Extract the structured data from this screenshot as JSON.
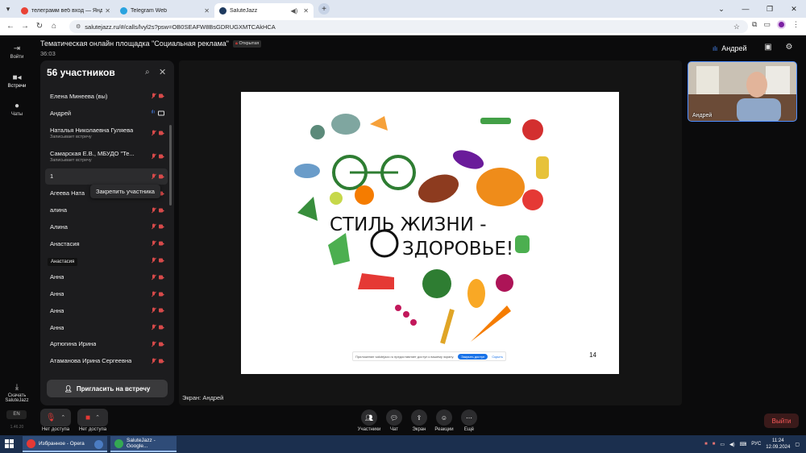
{
  "browser": {
    "tabs": [
      {
        "label": "телеграмм веб вход — Яндекс...",
        "color": "#e94235"
      },
      {
        "label": "Telegram Web",
        "color": "#2aa3df"
      },
      {
        "label": "SaluteJazz",
        "color": "#1e3a5f"
      }
    ],
    "url": "salutejazz.ru/#/calls/lvyl2s?psw=OB0SEAFW8BsGDRUGXMTCAkHCA"
  },
  "app": {
    "title": "Тематическая онлайн площадка \"Социальная реклама\"",
    "open_badge": "Открытая",
    "timer": "36:03",
    "user_name": "Андрей",
    "rail": [
      {
        "label": "Войти",
        "icon": "login-icon"
      },
      {
        "label": "Встречи",
        "icon": "video-icon"
      },
      {
        "label": "Чаты",
        "icon": "chat-icon"
      },
      {
        "label": "Скачать SaluteJazz",
        "icon": "download-icon"
      }
    ],
    "lang": "EN",
    "version": "1.46.20"
  },
  "participants": {
    "title": "56 участников",
    "rows": [
      {
        "name": "Елена Минеева (вы)",
        "sub": "",
        "icons": "off"
      },
      {
        "name": "Андрей",
        "sub": "",
        "icons": "on"
      },
      {
        "name": "Наталья Николаевна Гуляева",
        "sub": "Записывает встречу",
        "icons": "off"
      },
      {
        "name": "Самарская Е.В., МБУДО \"Те...",
        "sub": "Записывает встречу",
        "icons": "off"
      },
      {
        "name": "1",
        "sub": "",
        "icons": "off"
      },
      {
        "name": "Агеева Ната",
        "sub": "",
        "icons": "off"
      },
      {
        "name": "алина",
        "sub": "",
        "icons": "off"
      },
      {
        "name": "Алина",
        "sub": "",
        "icons": "off"
      },
      {
        "name": "Анастасия",
        "sub": "",
        "icons": "off"
      },
      {
        "name": "",
        "sub": "",
        "icons": "off"
      },
      {
        "name": "Анна",
        "sub": "",
        "icons": "off"
      },
      {
        "name": "Анна",
        "sub": "",
        "icons": "off"
      },
      {
        "name": "Анна",
        "sub": "",
        "icons": "off"
      },
      {
        "name": "Анна",
        "sub": "",
        "icons": "off"
      },
      {
        "name": "Артюгина Ирина",
        "sub": "",
        "icons": "off"
      },
      {
        "name": "Атаманова Ирина Сергеевна",
        "sub": "",
        "icons": "off"
      }
    ],
    "pin_tooltip": "Закрепить участника",
    "name_tooltip": "Анастасия",
    "invite_label": "Пригласить на встречу"
  },
  "stage": {
    "label": "Экран: Андрей",
    "slide_title_line1": "СТИЛЬ ЖИЗНИ -",
    "slide_title_line2": "ЗДОРОВЬЕ!",
    "page_number": "14",
    "share_banner_text": "Приложение salutejazz.ru предоставляет доступ к вашему экрану.",
    "share_banner_btn": "Закрыть доступ",
    "share_banner_link": "Скрыть"
  },
  "selfview": {
    "name": "Андрей"
  },
  "controls": {
    "mic_label": "Нет доступа",
    "cam_label": "Нет доступа",
    "center": [
      {
        "label": "Участники",
        "icon": "participants-icon"
      },
      {
        "label": "Чат",
        "icon": "chat-icon"
      },
      {
        "label": "Экран",
        "icon": "screen-share-icon"
      },
      {
        "label": "Реакции",
        "icon": "reactions-icon"
      },
      {
        "label": "Ещё",
        "icon": "more-icon"
      }
    ],
    "exit_label": "Выйти"
  },
  "taskbar": {
    "items": [
      {
        "label": "Избранное - Opera",
        "color": "#e53935"
      },
      {
        "label": "",
        "color": "#4b7cc2"
      },
      {
        "label": "SaluteJazz - Google...",
        "color": "#34a853"
      }
    ],
    "lang": "РУС",
    "time": "11:24",
    "date": "12.09.2024"
  }
}
